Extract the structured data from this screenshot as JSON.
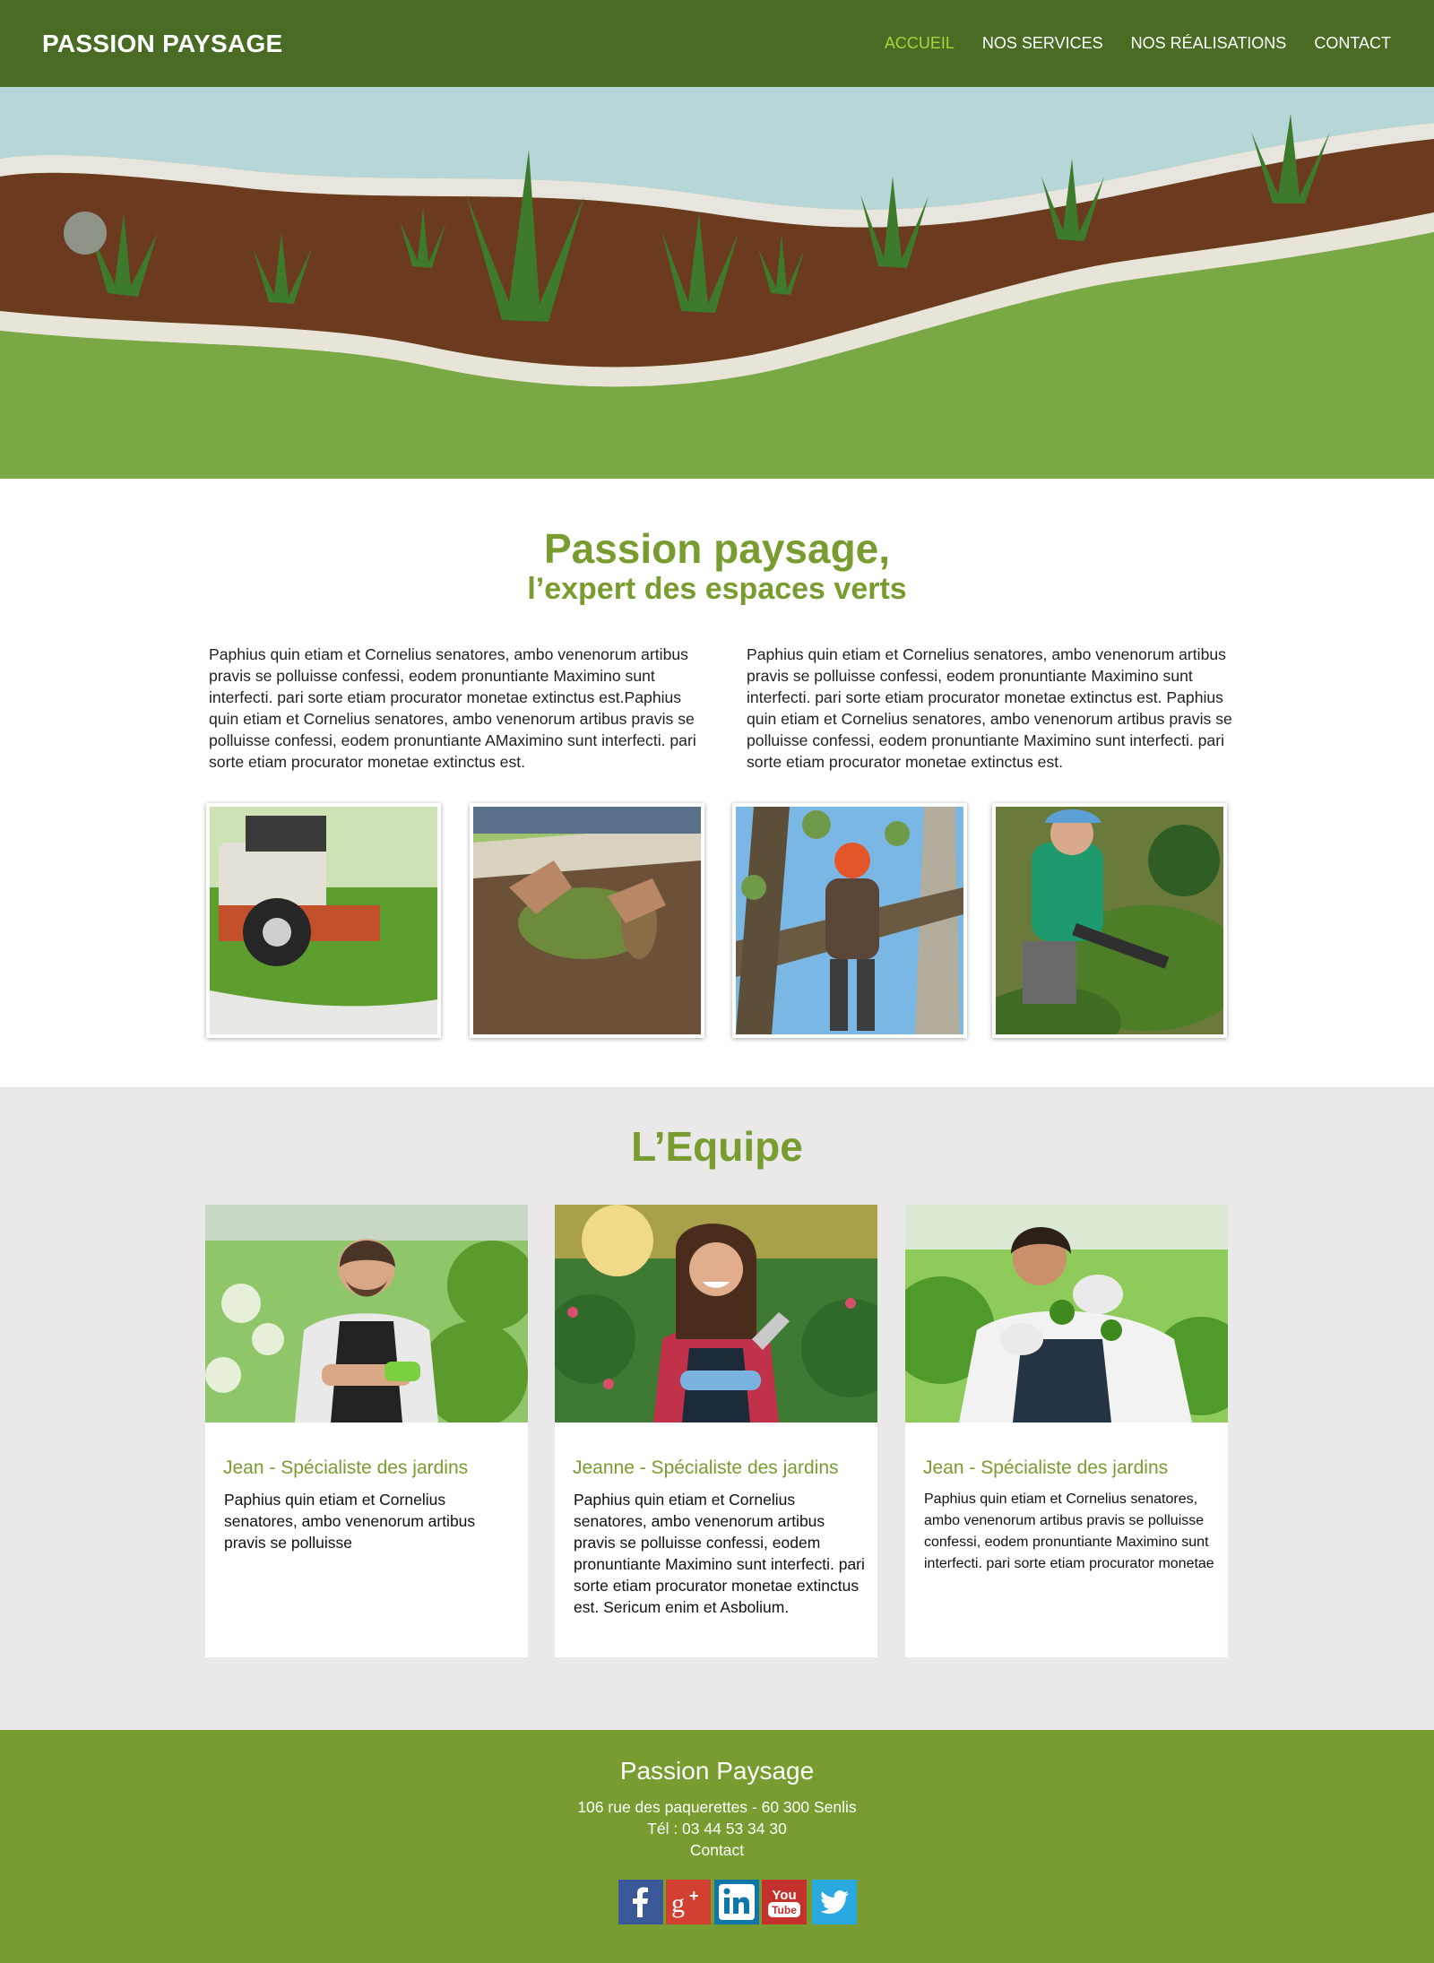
{
  "header": {
    "brand": "PASSION PAYSAGE",
    "nav": [
      {
        "label": "ACCUEIL",
        "active": true
      },
      {
        "label": "NOS SERVICES",
        "active": false
      },
      {
        "label": "NOS RÉALISATIONS",
        "active": false
      },
      {
        "label": "CONTACT",
        "active": false
      }
    ]
  },
  "hero": {
    "image": "garden-landscape-photo"
  },
  "intro": {
    "title": "Passion paysage,",
    "subtitle": "l’expert des espaces verts",
    "paragraph_left": "Paphius quin etiam et Cornelius senatores, ambo venenorum artibus pravis se polluisse confessi, eodem pronuntiante Maximino sunt interfecti. pari sorte etiam procurator monetae extinctus est.Paphius quin etiam et Cornelius senatores, ambo venenorum artibus pravis se polluisse confessi, eodem pronuntiante AMaximino sunt interfecti. pari sorte etiam procurator monetae extinctus est.",
    "paragraph_right": "Paphius quin etiam et Cornelius senatores, ambo venenorum artibus pravis se polluisse confessi, eodem pronuntiante Maximino sunt interfecti. pari sorte etiam procurator monetae extinctus est. Paphius quin etiam et Cornelius senatores, ambo venenorum artibus pravis se polluisse confessi, eodem pronuntiante Maximino sunt interfecti. pari sorte etiam procurator monetae extinctus est."
  },
  "services": {
    "photos": [
      "lawn-mower-photo",
      "turf-laying-photo",
      "tree-pruning-photo",
      "hedge-trimming-photo"
    ]
  },
  "team": {
    "title": "L’Equipe",
    "members": [
      {
        "name": "Jean - Spécialiste des jardins",
        "description": "Paphius quin etiam et Cornelius senatores, ambo venenorum artibus pravis se polluisse"
      },
      {
        "name": "Jeanne - Spécialiste des jardins",
        "description": "Paphius quin etiam et Cornelius senatores, ambo venenorum artibus pravis se polluisse confessi, eodem pronuntiante Maximino sunt interfecti. pari sorte etiam procurator monetae extinctus est. Sericum enim et Asbolium."
      },
      {
        "name": "Jean - Spécialiste des jardins",
        "description": "Paphius quin etiam et Cornelius senatores, ambo venenorum artibus pravis se polluisse confessi, eodem pronuntiante Maximino sunt interfecti. pari sorte etiam procurator monetae"
      }
    ]
  },
  "footer": {
    "title": "Passion Paysage",
    "address": "106 rue des paquerettes - 60 300 Senlis",
    "phone": "Tél : 03 44 53 34 30",
    "contact": "Contact",
    "social": [
      {
        "icon": "facebook-icon",
        "color": "#3b5998"
      },
      {
        "icon": "google-plus-icon",
        "color": "#d23f31"
      },
      {
        "icon": "linkedin-icon",
        "color": "#0e76a8"
      },
      {
        "icon": "youtube-icon",
        "color": "#c4302b"
      },
      {
        "icon": "twitter-icon",
        "color": "#2aa9e0"
      }
    ]
  },
  "colors": {
    "header_bg": "#4a6b24",
    "accent_green": "#789c2f",
    "nav_active": "#a6d63c",
    "team_bg": "#eae8e9"
  }
}
